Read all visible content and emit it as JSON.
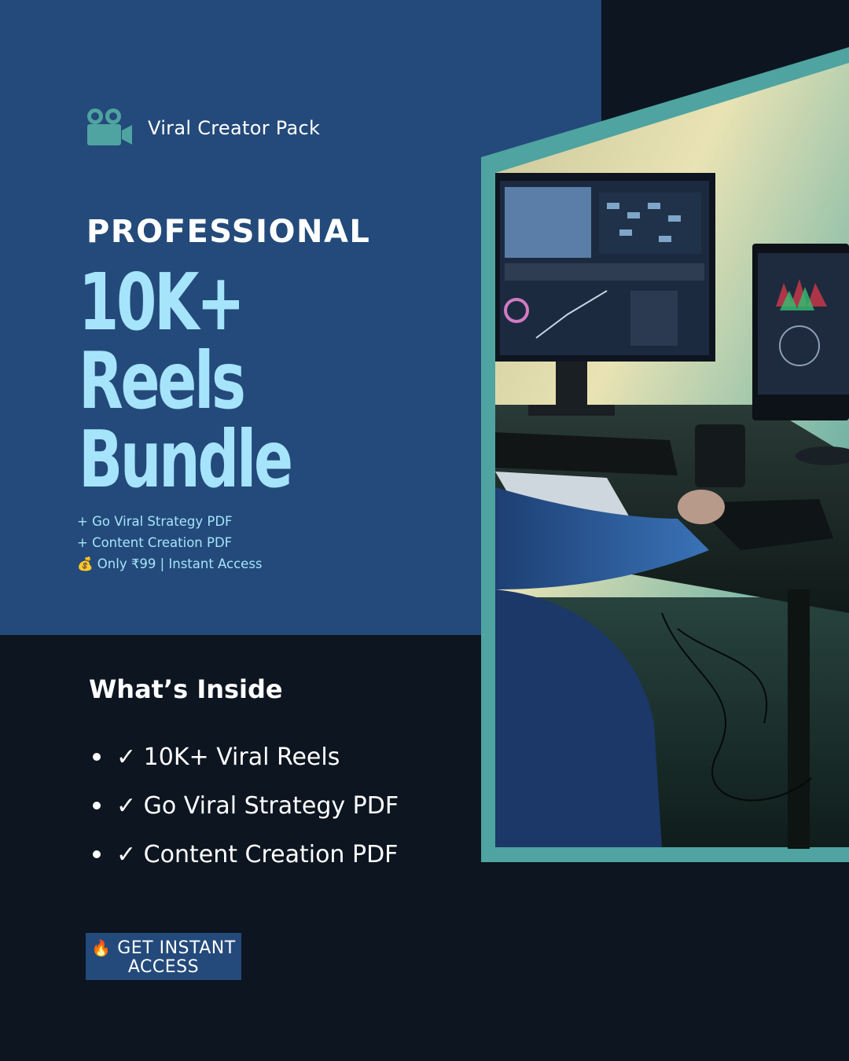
{
  "brand": {
    "icon": "movie-camera-icon",
    "name": "Viral Creator Pack"
  },
  "hero": {
    "eyebrow": "PROFESSIONAL",
    "headline": [
      "10K+",
      "Reels",
      "Bundle"
    ],
    "perks": [
      "+ Go Viral Strategy PDF",
      "+ Content Creation PDF",
      "💰 Only ₹99 | Instant Access"
    ]
  },
  "inside": {
    "title": "What’s Inside",
    "items": [
      "✓ 10K+ Viral Reels",
      "✓ Go Viral Strategy PDF",
      "✓ Content Creation PDF"
    ]
  },
  "cta": {
    "icon": "fire-icon",
    "label": "GET INSTANT ACCESS"
  },
  "photo": {
    "subject": "video-editing-workstation-photo"
  },
  "colors": {
    "panel_blue": "#234a7a",
    "dark_bg": "#0c1520",
    "accent_light": "#a6e4fb",
    "teal_frame": "#4fa3a0"
  }
}
